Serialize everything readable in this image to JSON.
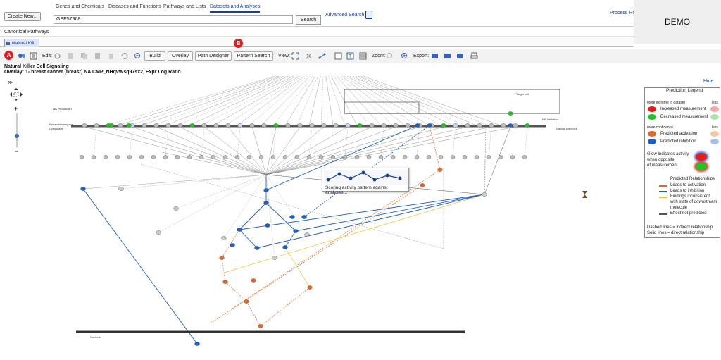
{
  "header": {
    "create_new": "Create New...",
    "tabs": [
      {
        "label": "Genes and Chemicals"
      },
      {
        "label": "Diseases and Functions"
      },
      {
        "label": "Pathways and Lists"
      },
      {
        "label": "Datasets and Analyses"
      }
    ],
    "active_tab": "Datasets and Analyses",
    "search_value": "GSE57968",
    "search_button": "Search",
    "advanced_search": "Advanced Search",
    "process_link": "Process RNA",
    "demo_label": "DEMO"
  },
  "breadcrumb": "Canonical Pathways",
  "doc_tab": "Natural Kill...",
  "toolbar": {
    "edit_label": "Edit:",
    "build": "Build",
    "overlay": "Overlay",
    "path_designer": "Path Designer",
    "pattern_search": "Pattern Search",
    "view_label": "View:",
    "zoom_label": "Zoom:",
    "export_label": "Export:"
  },
  "annotations": {
    "a": "A",
    "b": "B"
  },
  "pathway": {
    "title": "Natural Killer Cell Signaling",
    "overlay": "Overlay: 1- breast cancer [breast] NA CMP_NHqvWsq97sx2, Expr Log Ratio",
    "labels": {
      "nk_activation": "NK Activation",
      "extracellular": "Extracellular space",
      "cytoplasm": "Cytoplasm",
      "target_cell": "Target cell",
      "nk_inhibition": "NK Inhibition",
      "natural_killer_cell": "Natural killer cell",
      "nucleus": "Nucleus"
    }
  },
  "tooltip": "Scoring activity pattern against analyses...",
  "legend": {
    "hide": "Hide",
    "title": "Prediction Legend",
    "more_extreme": "more extreme in dataset",
    "less": "less",
    "increased": "Increased measurement",
    "decreased": "Decreased measurement",
    "more_confidence": "more confidence",
    "less2": "less",
    "pred_activation": "Predicted activation",
    "pred_inhibition": "Predicted inhibition",
    "glow1": "Glow Indicates activity",
    "glow2": "when opposite",
    "glow3": "of measurement",
    "rel_title": "Predicted Relationships",
    "leads_activation": "Leads to activation",
    "leads_inhibition": "Leads to inhibition",
    "findings1": "Findings inconsistent",
    "findings2": "with state of downstream",
    "findings3": "molecule",
    "effect_not": "Effect not predicted",
    "dashed": "Dashed lines = indirect relationship",
    "solid": "Solid lines = direct relationship"
  },
  "colors": {
    "increased": "#e02020",
    "decreased": "#22c322",
    "activation": "#e0682a",
    "inhibition": "#1f5fbf",
    "inconsistent": "#e8c030",
    "not_predicted": "#555555"
  }
}
